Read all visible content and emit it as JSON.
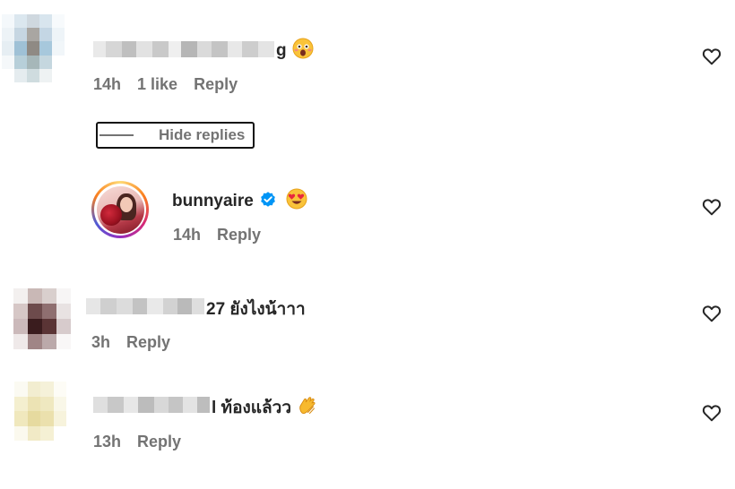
{
  "comments": [
    {
      "username_tail": "g",
      "emoji": "astonished-face",
      "time": "14h",
      "likes": "1 like",
      "reply_label": "Reply"
    },
    {
      "username_tail": "27 ยังไงน้าาา",
      "time": "3h",
      "reply_label": "Reply"
    },
    {
      "username_tail": "l ท้องแล้วว",
      "emoji": "clapping-hands",
      "time": "13h",
      "reply_label": "Reply"
    }
  ],
  "replies_toggle": {
    "label": "Hide replies"
  },
  "reply": {
    "username": "bunnyaire",
    "verified": true,
    "emoji": "heart-eyes-face",
    "time": "14h",
    "reply_label": "Reply"
  },
  "colors": {
    "text": "#262626",
    "meta": "#737373",
    "verified": "#0095f6"
  }
}
